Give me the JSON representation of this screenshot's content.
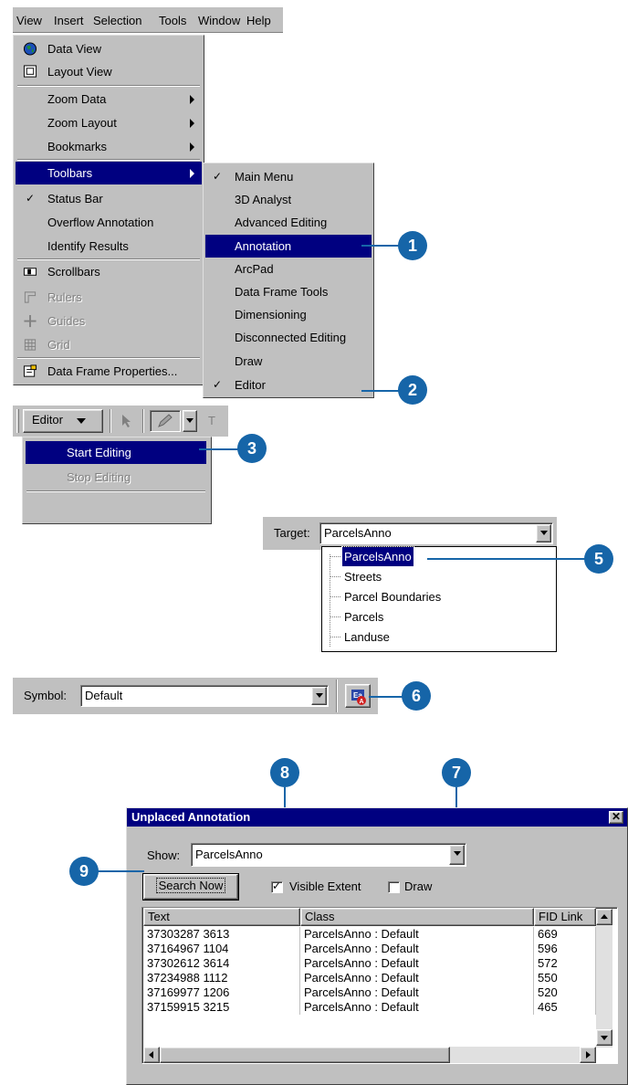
{
  "menubar": [
    "View",
    "Insert",
    "Selection",
    "Tools",
    "Window",
    "Help"
  ],
  "view_menu": {
    "items": [
      {
        "label": "Data View",
        "icon": "globe-icon"
      },
      {
        "label": "Layout View",
        "icon": "page-icon"
      },
      {
        "label": "Zoom Data",
        "submenu": true
      },
      {
        "label": "Zoom Layout",
        "submenu": true
      },
      {
        "label": "Bookmarks",
        "submenu": true
      },
      {
        "label": "Toolbars",
        "submenu": true,
        "selected": true
      },
      {
        "label": "Status Bar",
        "checked": true
      },
      {
        "label": "Overflow Annotation"
      },
      {
        "label": "Identify Results"
      },
      {
        "label": "Scrollbars",
        "icon": "scrollbar-icon"
      },
      {
        "label": "Rulers",
        "disabled": true,
        "icon": "ruler-icon"
      },
      {
        "label": "Guides",
        "disabled": true,
        "icon": "guides-icon"
      },
      {
        "label": "Grid",
        "disabled": true,
        "icon": "grid-icon"
      },
      {
        "label": "Data Frame Properties...",
        "icon": "properties-icon"
      }
    ]
  },
  "toolbars_submenu": {
    "items": [
      {
        "label": "Main Menu",
        "checked": true
      },
      {
        "label": "3D Analyst"
      },
      {
        "label": "Advanced Editing"
      },
      {
        "label": "Annotation",
        "selected": true
      },
      {
        "label": "ArcPad"
      },
      {
        "label": "Data Frame Tools"
      },
      {
        "label": "Dimensioning"
      },
      {
        "label": "Disconnected Editing"
      },
      {
        "label": "Draw"
      },
      {
        "label": "Editor",
        "checked": true
      }
    ]
  },
  "callouts": [
    "1",
    "2",
    "3",
    "5",
    "6",
    "7",
    "8",
    "9"
  ],
  "editor_toolbar": {
    "editor_label": "Editor",
    "menu": [
      "Start Editing",
      "Stop Editing"
    ],
    "truncated_label": "T"
  },
  "target": {
    "label": "Target:",
    "value": "ParcelsAnno",
    "options": [
      "ParcelsAnno",
      "Streets",
      "Parcel Boundaries",
      "Parcels",
      "Landuse"
    ]
  },
  "symbol": {
    "label": "Symbol:",
    "value": "Default"
  },
  "unplaced": {
    "title": "Unplaced Annotation",
    "show_label": "Show:",
    "show_value": "ParcelsAnno",
    "search_button": "Search Now",
    "visible_extent": "Visible Extent",
    "visible_extent_checked": true,
    "draw": "Draw",
    "draw_checked": false,
    "columns": [
      "Text",
      "Class",
      "FID Link"
    ],
    "rows": [
      [
        "37303287 3613",
        "ParcelsAnno : Default",
        "669"
      ],
      [
        "37164967 1104",
        "ParcelsAnno : Default",
        "596"
      ],
      [
        "37302612 3614",
        "ParcelsAnno : Default",
        "572"
      ],
      [
        "37234988 1112",
        "ParcelsAnno : Default",
        "550"
      ],
      [
        "37169977 1206",
        "ParcelsAnno : Default",
        "520"
      ],
      [
        "37159915 3215",
        "ParcelsAnno : Default",
        "465"
      ]
    ]
  },
  "colors": {
    "highlight": "#000080",
    "callout": "#1665a8",
    "face": "#c0c0c0"
  }
}
